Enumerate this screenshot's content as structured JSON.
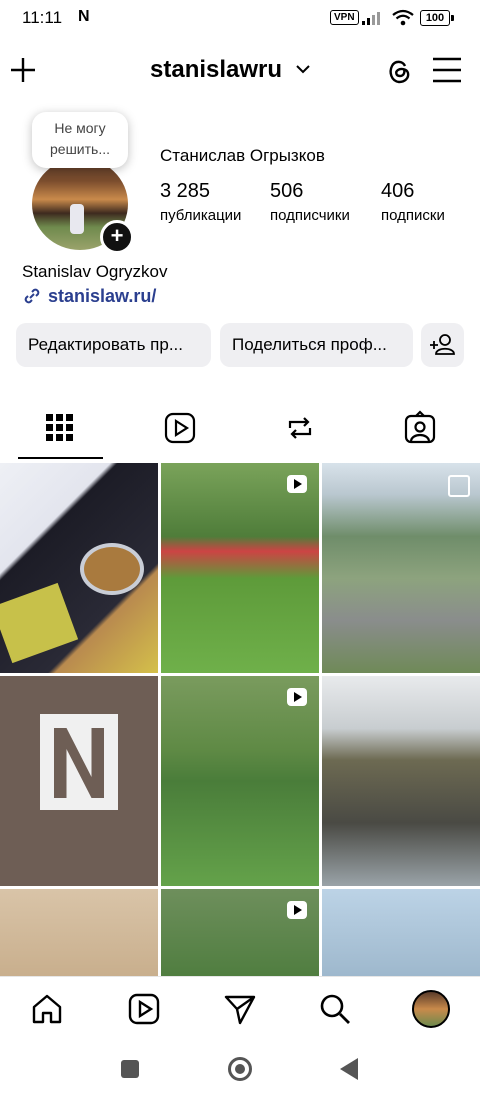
{
  "status": {
    "time": "11:11",
    "notif_icon": "N",
    "vpn": "VPN",
    "battery": "100"
  },
  "header": {
    "username": "stanislawru",
    "chevron": "⌄"
  },
  "profile": {
    "tooltip": "Не могу решить...",
    "full_name": "Станислав Огрызков",
    "stats": [
      {
        "number": "3 285",
        "label": "публикации"
      },
      {
        "number": "506",
        "label": "подписчики"
      },
      {
        "number": "406",
        "label": "подписки"
      }
    ],
    "latin_name": "Stanislav Ogryzkov",
    "link": "stanislaw.ru/"
  },
  "buttons": {
    "edit": "Редактировать пр...",
    "share": "Поделиться проф..."
  },
  "tabs": [
    "grid-icon",
    "reels-icon",
    "reposts-icon",
    "tagged-icon"
  ],
  "colors": {
    "link": "#2b3f8f",
    "button_bg": "#efeff2"
  }
}
